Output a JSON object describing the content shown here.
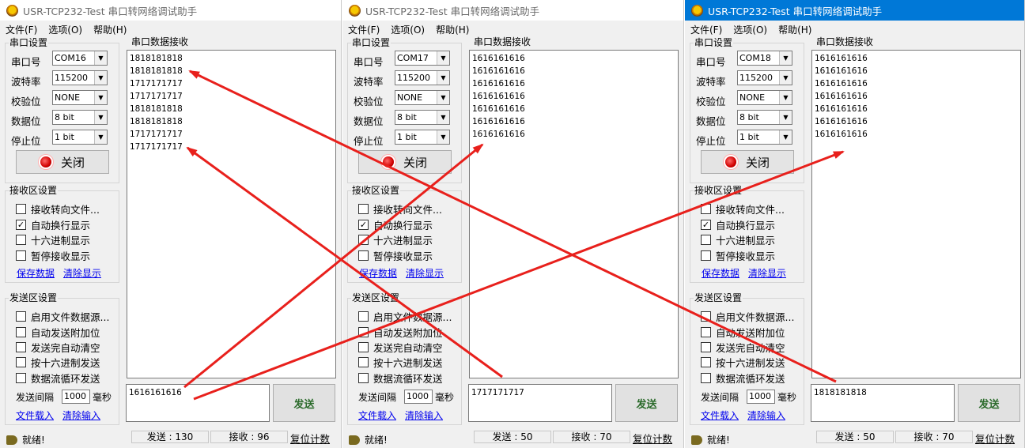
{
  "windows": [
    {
      "title": "USR-TCP232-Test 串口转网络调试助手",
      "active": false,
      "menu": [
        "文件(F)",
        "选项(O)",
        "帮助(H)"
      ],
      "serial_settings": {
        "title": "串口设置",
        "port_label": "串口号",
        "port": "COM16",
        "baud_label": "波特率",
        "baud": "115200",
        "parity_label": "校验位",
        "parity": "NONE",
        "databits_label": "数据位",
        "databits": "8 bit",
        "stopbits_label": "停止位",
        "stopbits": "1 bit",
        "toggle_label": "关闭"
      },
      "recv_settings": {
        "title": "接收区设置",
        "opt1": "接收转向文件...",
        "opt1_checked": false,
        "opt2": "自动换行显示",
        "opt2_checked": true,
        "opt3": "十六进制显示",
        "opt3_checked": false,
        "opt4": "暂停接收显示",
        "opt4_checked": false,
        "save_link": "保存数据",
        "clear_link": "清除显示"
      },
      "send_settings": {
        "title": "发送区设置",
        "opt1": "启用文件数据源...",
        "opt2": "自动发送附加位",
        "opt3": "发送完自动清空",
        "opt4": "按十六进制发送",
        "opt5": "数据流循环发送",
        "interval_label": "发送间隔",
        "interval": "1000",
        "interval_unit": "毫秒",
        "load_link": "文件载入",
        "clear_link": "清除输入"
      },
      "recv_panel_title": "串口数据接收",
      "recv_lines": [
        "1818181818",
        "1818181818",
        "1717171717",
        "1717171717",
        "1818181818",
        "1818181818",
        "1717171717",
        "1717171717"
      ],
      "send_text": "1616161616",
      "send_button": "发送",
      "status": {
        "ready": "就绪!",
        "sent": "发送 : 130",
        "recv": "接收 : 96",
        "reset": "复位计数"
      }
    },
    {
      "title": "USR-TCP232-Test 串口转网络调试助手",
      "active": false,
      "menu": [
        "文件(F)",
        "选项(O)",
        "帮助(H)"
      ],
      "serial_settings": {
        "title": "串口设置",
        "port_label": "串口号",
        "port": "COM17",
        "baud_label": "波特率",
        "baud": "115200",
        "parity_label": "校验位",
        "parity": "NONE",
        "databits_label": "数据位",
        "databits": "8 bit",
        "stopbits_label": "停止位",
        "stopbits": "1 bit",
        "toggle_label": "关闭"
      },
      "recv_settings": {
        "title": "接收区设置",
        "opt1": "接收转向文件...",
        "opt1_checked": false,
        "opt2": "自动换行显示",
        "opt2_checked": true,
        "opt3": "十六进制显示",
        "opt3_checked": false,
        "opt4": "暂停接收显示",
        "opt4_checked": false,
        "save_link": "保存数据",
        "clear_link": "清除显示"
      },
      "send_settings": {
        "title": "发送区设置",
        "opt1": "启用文件数据源...",
        "opt2": "自动发送附加位",
        "opt3": "发送完自动清空",
        "opt4": "按十六进制发送",
        "opt5": "数据流循环发送",
        "interval_label": "发送间隔",
        "interval": "1000",
        "interval_unit": "毫秒",
        "load_link": "文件载入",
        "clear_link": "清除输入"
      },
      "recv_panel_title": "串口数据接收",
      "recv_lines": [
        "1616161616",
        "1616161616",
        "1616161616",
        "1616161616",
        "1616161616",
        "1616161616",
        "1616161616"
      ],
      "send_text": "1717171717",
      "send_button": "发送",
      "status": {
        "ready": "就绪!",
        "sent": "发送 : 50",
        "recv": "接收 : 70",
        "reset": "复位计数"
      }
    },
    {
      "title": "USR-TCP232-Test 串口转网络调试助手",
      "active": true,
      "menu": [
        "文件(F)",
        "选项(O)",
        "帮助(H)"
      ],
      "serial_settings": {
        "title": "串口设置",
        "port_label": "串口号",
        "port": "COM18",
        "baud_label": "波特率",
        "baud": "115200",
        "parity_label": "校验位",
        "parity": "NONE",
        "databits_label": "数据位",
        "databits": "8 bit",
        "stopbits_label": "停止位",
        "stopbits": "1 bit",
        "toggle_label": "关闭"
      },
      "recv_settings": {
        "title": "接收区设置",
        "opt1": "接收转向文件...",
        "opt1_checked": false,
        "opt2": "自动换行显示",
        "opt2_checked": true,
        "opt3": "十六进制显示",
        "opt3_checked": false,
        "opt4": "暂停接收显示",
        "opt4_checked": false,
        "save_link": "保存数据",
        "clear_link": "清除显示"
      },
      "send_settings": {
        "title": "发送区设置",
        "opt1": "启用文件数据源...",
        "opt2": "自动发送附加位",
        "opt3": "发送完自动清空",
        "opt4": "按十六进制发送",
        "opt5": "数据流循环发送",
        "interval_label": "发送间隔",
        "interval": "1000",
        "interval_unit": "毫秒",
        "load_link": "文件载入",
        "clear_link": "清除输入"
      },
      "recv_panel_title": "串口数据接收",
      "recv_lines": [
        "1616161616",
        "1616161616",
        "1616161616",
        "1616161616",
        "1616161616",
        "1616161616",
        "1616161616"
      ],
      "send_text": "1818181818",
      "send_button": "发送",
      "status": {
        "ready": "就绪!",
        "sent": "发送 : 50",
        "recv": "接收 : 70",
        "reset": "复位计数"
      }
    }
  ],
  "colors": {
    "annotation_arrow": "#e8201c",
    "active_titlebar": "#0078d7"
  }
}
